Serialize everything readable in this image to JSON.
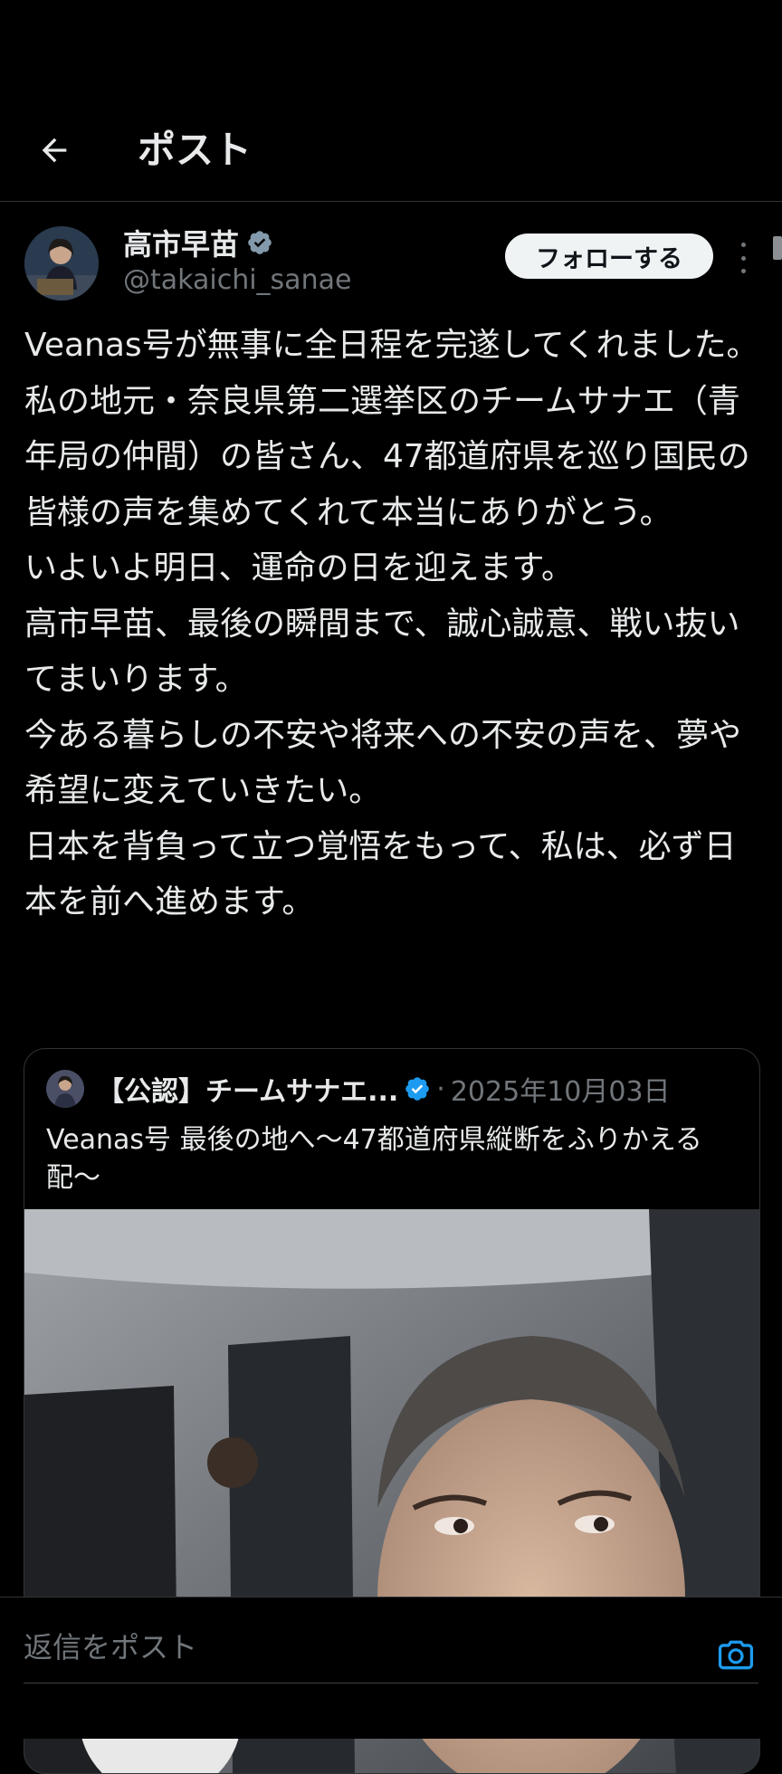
{
  "header": {
    "title": "ポスト"
  },
  "post": {
    "author_name": "高市早苗",
    "handle": "@takaichi_sanae",
    "follow_label": "フォローする",
    "body": "Veanas号が無事に全日程を完遂してくれました。\n私の地元・奈良県第二選挙区のチームサナエ（青年局の仲間）の皆さん、47都道府県を巡り国民の皆様の声を集めてくれて本当にありがとう。\nいよいよ明日、運命の日を迎えます。\n高市早苗、最後の瞬間まで、誠心誠意、戦い抜いてまいります。\n今ある暮らしの不安や将来への不安の声を、夢や希望に変えていきたい。\n日本を背負って立つ覚悟をもって、私は、必ず日本を前へ進めます。"
  },
  "quote": {
    "author_name": "【公認】チームサナエ...",
    "separator": "·",
    "date": "2025年10月03日",
    "text": "Veanas号 最後の地へ〜47都道府県縦断をふりかえる配〜"
  },
  "reply": {
    "placeholder": "返信をポスト"
  },
  "colors": {
    "background": "#000000",
    "text": "#e7e9ea",
    "muted": "#71767b",
    "accent": "#1d9bf0"
  },
  "icons": {
    "back": "arrow-left-icon",
    "verified": "verified-badge-icon",
    "more": "more-vertical-icon",
    "camera": "camera-icon"
  }
}
